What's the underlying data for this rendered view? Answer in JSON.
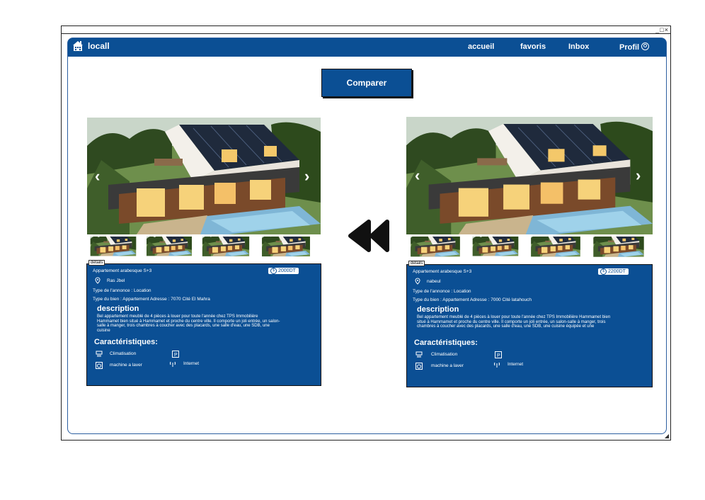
{
  "window": {
    "controls": "_□×",
    "resize_grip": "◢"
  },
  "nav": {
    "brand": "locall",
    "items": [
      "accueil",
      "favoris",
      "Inbox",
      "Profil"
    ]
  },
  "compare_label": "Comparer",
  "icons": {
    "rewind": "rewind-icon",
    "prev": "chevron-left-icon",
    "next": "chevron-right-icon"
  },
  "listings": [
    {
      "detail_tag": "détails",
      "title": "Appartement arabesque S+3",
      "price": "2000DT",
      "location": "Ras Jbel",
      "type_annonce": "Type de l'annonce : Location",
      "type_bien": "Type du bien : Appartement Adresse : 7070 Cité El Mahra",
      "desc_heading": "description",
      "description": "Bel appartement meublé de 4 pièces à louer pour toute l'année chez TPS Immobilière Hammamet bien situé à Hammamet et proche du centre ville. Il comporte un joli entrée, un salon-salle à manger, trois chambres à coucher avec des placards, une salle d'eau, une SDB, une cuisine",
      "features_heading": "Caractéristiques:",
      "features": [
        "Climatisation",
        "machine a laver",
        "Internet"
      ]
    },
    {
      "detail_tag": "détails",
      "title": "Appartement arabesque S+3",
      "price": "2200DT",
      "location": "nabeul",
      "type_annonce": "Type de l'annonce : Location",
      "type_bien": "Type du bien : Appartement Adresse : 7000 Cité latahouch",
      "desc_heading": "description",
      "description": "Bel appartement meublé de 4 pièces à louer pour toute l'année chez TPS Immobilière Hammamet bien situé à Hammamet et proche du centre ville. Il comporte un joli entrée, un salon-salle à manger, trois chambres à coucher avec des placards, une salle d'eau, une SDB, une cuisine équipée et une",
      "features_heading": "Caractéristiques:",
      "features": [
        "Climatisation",
        "machine a laver",
        "Internet"
      ]
    }
  ]
}
